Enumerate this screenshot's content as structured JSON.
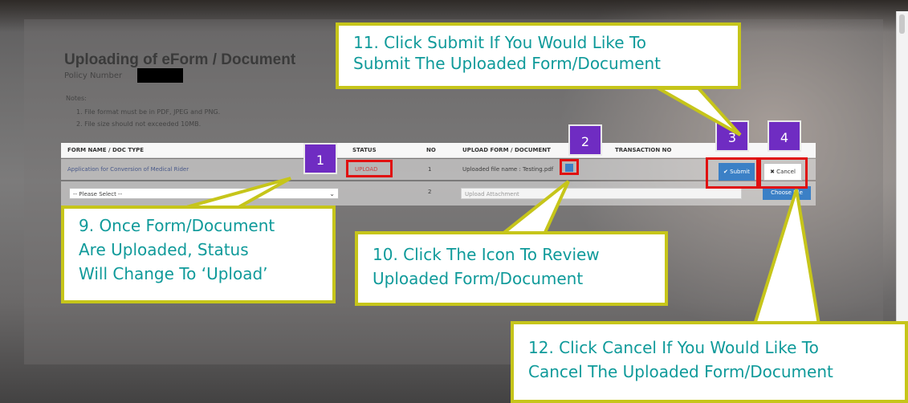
{
  "dialog": {
    "title": "Uploading of eForm / Document",
    "policy_label": "Policy Number",
    "notes_header": "Notes:",
    "notes": [
      "1. File format must be in PDF, JPEG and PNG.",
      "2. File size should not exceeded 10MB."
    ]
  },
  "table": {
    "headers": [
      "FORM NAME / DOC TYPE",
      "STATUS",
      "NO",
      "UPLOAD FORM / DOCUMENT",
      "TRANSACTION NO"
    ],
    "row1": {
      "form": "Application for Conversion of Medical Rider",
      "status": "UPLOAD",
      "no": "1",
      "file": "Uploaded file name : Testing.pdf"
    },
    "row2": {
      "select_value": "-- Please Select --",
      "no": "2",
      "upload_placeholder": "Upload Attachment",
      "choose_label": "Choose File"
    }
  },
  "buttons": {
    "submit": "✔ Submit",
    "cancel": "✖ Cancel"
  },
  "markers": [
    "1",
    "2",
    "3",
    "4"
  ],
  "callouts": {
    "c11": [
      "11. Click Submit If You Would Like To",
      "Submit The Uploaded Form/Document"
    ],
    "c9": [
      "9. Once Form/Document",
      "Are Uploaded, Status",
      "Will Change To ‘Upload’"
    ],
    "c10": [
      "10. Click The Icon To Review",
      "Uploaded Form/Document"
    ],
    "c12": [
      "12. Click Cancel If You Would Like To",
      "Cancel The Uploaded Form/Document"
    ]
  },
  "colors": {
    "accent": "#3b80c6",
    "highlight": "#e01010",
    "marker": "#6f2cc2",
    "callout_border": "#c6c51a",
    "callout_text": "#0f9a9a"
  }
}
